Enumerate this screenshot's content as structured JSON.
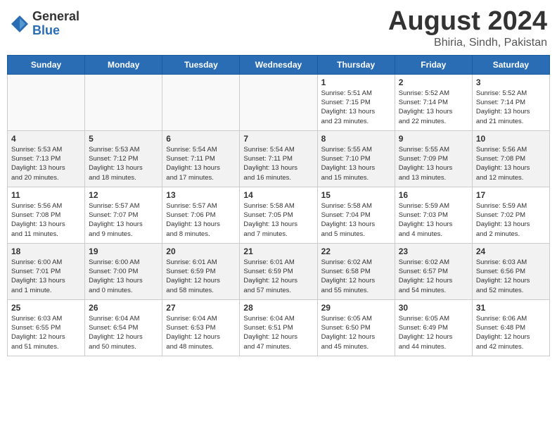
{
  "header": {
    "logo_general": "General",
    "logo_blue": "Blue",
    "month_year": "August 2024",
    "location": "Bhiria, Sindh, Pakistan"
  },
  "days_of_week": [
    "Sunday",
    "Monday",
    "Tuesday",
    "Wednesday",
    "Thursday",
    "Friday",
    "Saturday"
  ],
  "weeks": [
    [
      {
        "day": "",
        "info": ""
      },
      {
        "day": "",
        "info": ""
      },
      {
        "day": "",
        "info": ""
      },
      {
        "day": "",
        "info": ""
      },
      {
        "day": "1",
        "info": "Sunrise: 5:51 AM\nSunset: 7:15 PM\nDaylight: 13 hours\nand 23 minutes."
      },
      {
        "day": "2",
        "info": "Sunrise: 5:52 AM\nSunset: 7:14 PM\nDaylight: 13 hours\nand 22 minutes."
      },
      {
        "day": "3",
        "info": "Sunrise: 5:52 AM\nSunset: 7:14 PM\nDaylight: 13 hours\nand 21 minutes."
      }
    ],
    [
      {
        "day": "4",
        "info": "Sunrise: 5:53 AM\nSunset: 7:13 PM\nDaylight: 13 hours\nand 20 minutes."
      },
      {
        "day": "5",
        "info": "Sunrise: 5:53 AM\nSunset: 7:12 PM\nDaylight: 13 hours\nand 18 minutes."
      },
      {
        "day": "6",
        "info": "Sunrise: 5:54 AM\nSunset: 7:11 PM\nDaylight: 13 hours\nand 17 minutes."
      },
      {
        "day": "7",
        "info": "Sunrise: 5:54 AM\nSunset: 7:11 PM\nDaylight: 13 hours\nand 16 minutes."
      },
      {
        "day": "8",
        "info": "Sunrise: 5:55 AM\nSunset: 7:10 PM\nDaylight: 13 hours\nand 15 minutes."
      },
      {
        "day": "9",
        "info": "Sunrise: 5:55 AM\nSunset: 7:09 PM\nDaylight: 13 hours\nand 13 minutes."
      },
      {
        "day": "10",
        "info": "Sunrise: 5:56 AM\nSunset: 7:08 PM\nDaylight: 13 hours\nand 12 minutes."
      }
    ],
    [
      {
        "day": "11",
        "info": "Sunrise: 5:56 AM\nSunset: 7:08 PM\nDaylight: 13 hours\nand 11 minutes."
      },
      {
        "day": "12",
        "info": "Sunrise: 5:57 AM\nSunset: 7:07 PM\nDaylight: 13 hours\nand 9 minutes."
      },
      {
        "day": "13",
        "info": "Sunrise: 5:57 AM\nSunset: 7:06 PM\nDaylight: 13 hours\nand 8 minutes."
      },
      {
        "day": "14",
        "info": "Sunrise: 5:58 AM\nSunset: 7:05 PM\nDaylight: 13 hours\nand 7 minutes."
      },
      {
        "day": "15",
        "info": "Sunrise: 5:58 AM\nSunset: 7:04 PM\nDaylight: 13 hours\nand 5 minutes."
      },
      {
        "day": "16",
        "info": "Sunrise: 5:59 AM\nSunset: 7:03 PM\nDaylight: 13 hours\nand 4 minutes."
      },
      {
        "day": "17",
        "info": "Sunrise: 5:59 AM\nSunset: 7:02 PM\nDaylight: 13 hours\nand 2 minutes."
      }
    ],
    [
      {
        "day": "18",
        "info": "Sunrise: 6:00 AM\nSunset: 7:01 PM\nDaylight: 13 hours\nand 1 minute."
      },
      {
        "day": "19",
        "info": "Sunrise: 6:00 AM\nSunset: 7:00 PM\nDaylight: 13 hours\nand 0 minutes."
      },
      {
        "day": "20",
        "info": "Sunrise: 6:01 AM\nSunset: 6:59 PM\nDaylight: 12 hours\nand 58 minutes."
      },
      {
        "day": "21",
        "info": "Sunrise: 6:01 AM\nSunset: 6:59 PM\nDaylight: 12 hours\nand 57 minutes."
      },
      {
        "day": "22",
        "info": "Sunrise: 6:02 AM\nSunset: 6:58 PM\nDaylight: 12 hours\nand 55 minutes."
      },
      {
        "day": "23",
        "info": "Sunrise: 6:02 AM\nSunset: 6:57 PM\nDaylight: 12 hours\nand 54 minutes."
      },
      {
        "day": "24",
        "info": "Sunrise: 6:03 AM\nSunset: 6:56 PM\nDaylight: 12 hours\nand 52 minutes."
      }
    ],
    [
      {
        "day": "25",
        "info": "Sunrise: 6:03 AM\nSunset: 6:55 PM\nDaylight: 12 hours\nand 51 minutes."
      },
      {
        "day": "26",
        "info": "Sunrise: 6:04 AM\nSunset: 6:54 PM\nDaylight: 12 hours\nand 50 minutes."
      },
      {
        "day": "27",
        "info": "Sunrise: 6:04 AM\nSunset: 6:53 PM\nDaylight: 12 hours\nand 48 minutes."
      },
      {
        "day": "28",
        "info": "Sunrise: 6:04 AM\nSunset: 6:51 PM\nDaylight: 12 hours\nand 47 minutes."
      },
      {
        "day": "29",
        "info": "Sunrise: 6:05 AM\nSunset: 6:50 PM\nDaylight: 12 hours\nand 45 minutes."
      },
      {
        "day": "30",
        "info": "Sunrise: 6:05 AM\nSunset: 6:49 PM\nDaylight: 12 hours\nand 44 minutes."
      },
      {
        "day": "31",
        "info": "Sunrise: 6:06 AM\nSunset: 6:48 PM\nDaylight: 12 hours\nand 42 minutes."
      }
    ]
  ]
}
